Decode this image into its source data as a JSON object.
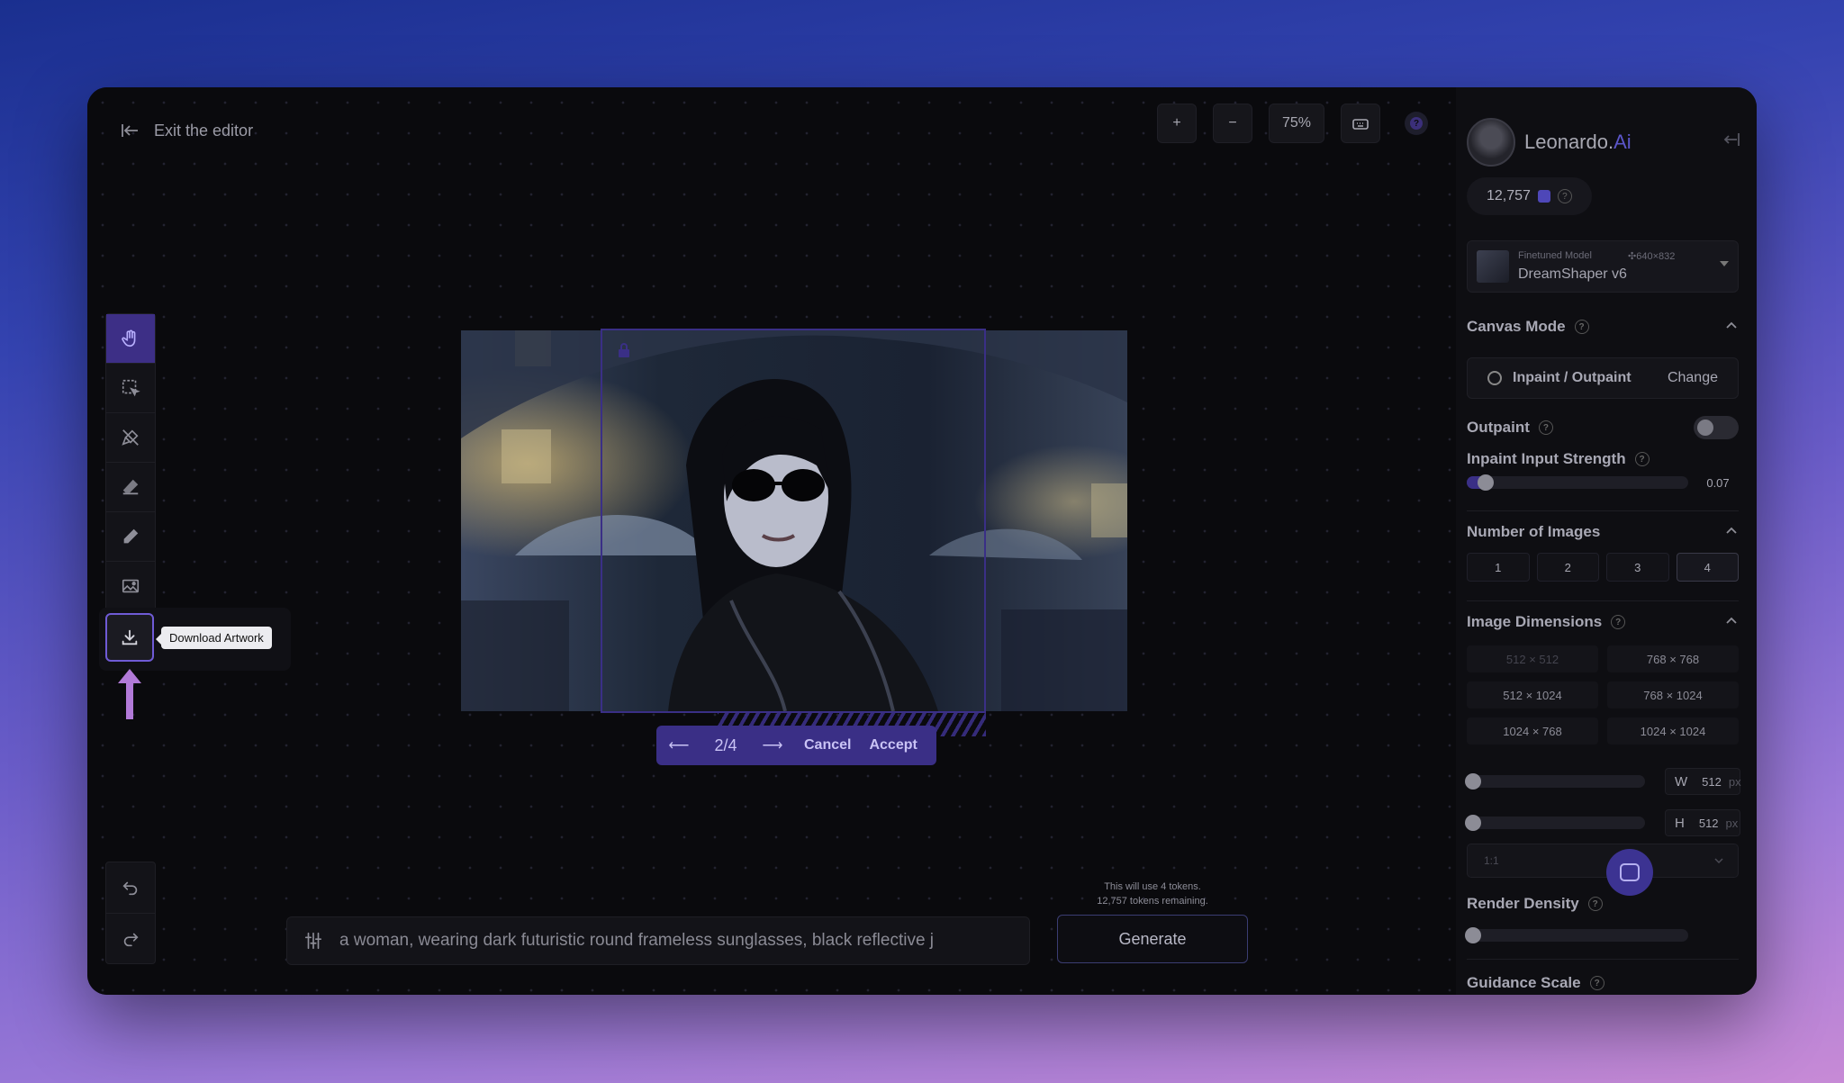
{
  "editor": {
    "exit_label": "Exit the editor",
    "zoom_level": "75%",
    "zoom_in": "+",
    "zoom_out": "−",
    "tools": [
      "pan-tool",
      "select-tool",
      "erase-mask-tool",
      "eraser-tool",
      "draw-tool",
      "image-tool"
    ],
    "download_tooltip": "Download Artwork"
  },
  "candidate_nav": {
    "counter": "2/4",
    "cancel_label": "Cancel",
    "accept_label": "Accept"
  },
  "prompt": {
    "value": "a woman, wearing dark futuristic round frameless sunglasses, black reflective j"
  },
  "generate": {
    "label": "Generate",
    "token_line1": "This will use 4 tokens.",
    "token_line2": "12,757 tokens remaining."
  },
  "panel": {
    "brand_main": "Leonardo.",
    "brand_ai": "Ai",
    "credits": "12,757",
    "model": {
      "type_label": "Finetuned Model",
      "dimensions": "640×832",
      "name": "DreamShaper v6"
    },
    "canvas_mode": {
      "title": "Canvas Mode",
      "mode": "Inpaint / Outpaint",
      "change_label": "Change"
    },
    "outpaint": {
      "label": "Outpaint",
      "enabled": false
    },
    "inpaint_strength": {
      "label": "Inpaint Input Strength",
      "value": "0.07"
    },
    "number_of_images": {
      "title": "Number of Images",
      "options": [
        "1",
        "2",
        "3",
        "4"
      ],
      "selected": "4"
    },
    "image_dimensions": {
      "title": "Image Dimensions",
      "options": [
        "512 × 512",
        "768 × 768",
        "512 × 1024",
        "768 × 1024",
        "1024 × 768",
        "1024 × 1024"
      ],
      "width_label": "W",
      "width_value": "512",
      "height_label": "H",
      "height_value": "512",
      "unit": "px",
      "aspect": "1:1"
    },
    "render_density": {
      "title": "Render Density"
    },
    "guidance_scale": {
      "title": "Guidance Scale"
    }
  },
  "colors": {
    "accent": "#3a2f86",
    "panel_bg": "#0e0e12",
    "canvas_bg": "#0a0a0d"
  }
}
